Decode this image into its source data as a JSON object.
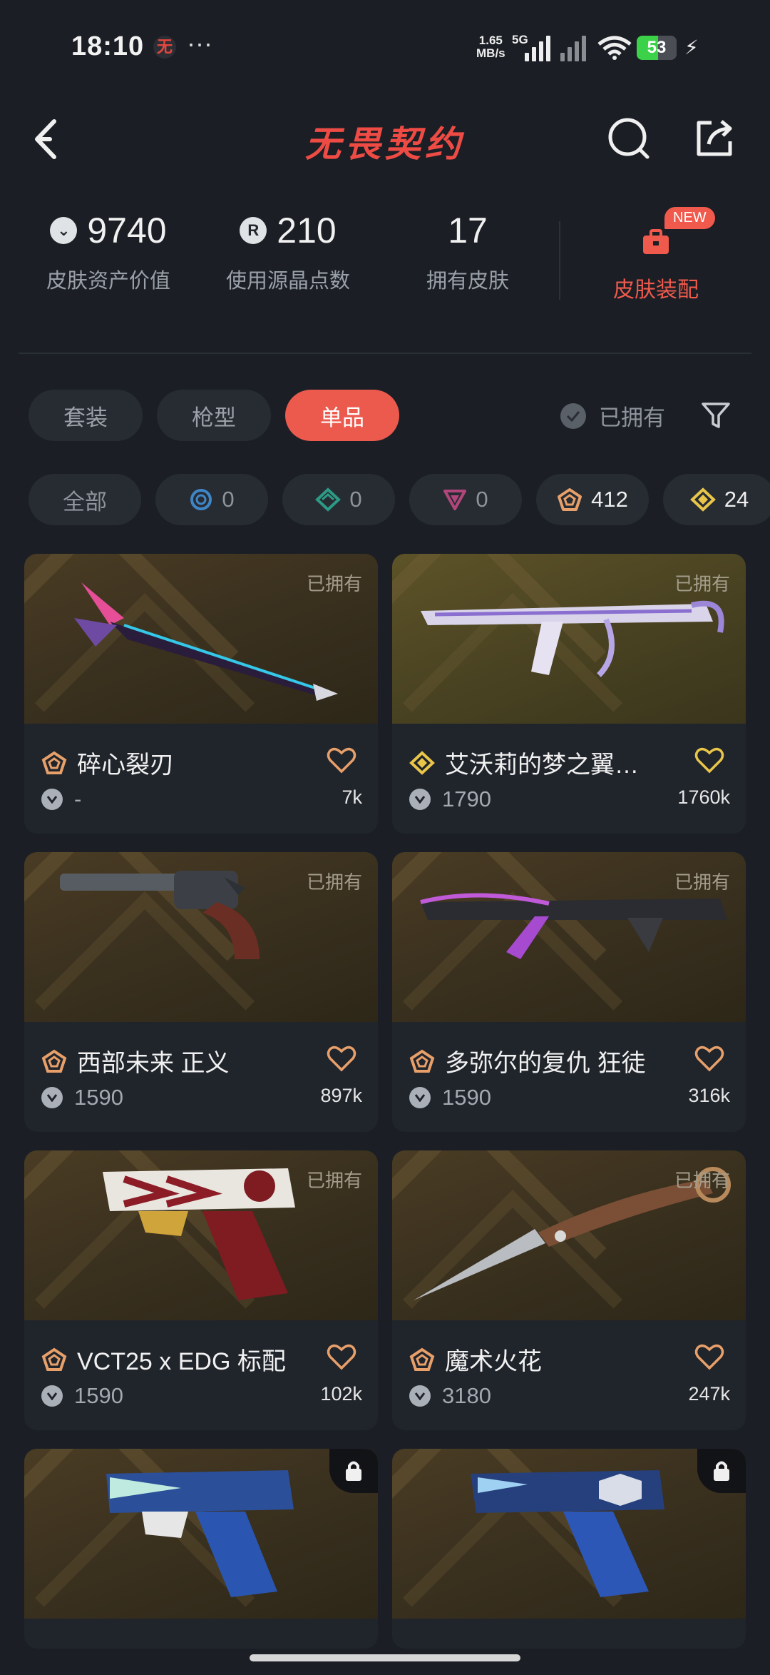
{
  "status_bar": {
    "time": "18:10",
    "app_badge": "无",
    "dots": "···",
    "speed_value": "1.65",
    "speed_unit": "MB/s",
    "network": "5G",
    "battery": "53",
    "battery_level": 0.53
  },
  "header": {
    "title": "无畏契约"
  },
  "stats": [
    {
      "value": "9740",
      "label": "皮肤资产价值",
      "icon": "vp-coin-icon"
    },
    {
      "value": "210",
      "label": "使用源晶点数",
      "icon": "radianite-icon"
    },
    {
      "value": "17",
      "label": "拥有皮肤"
    }
  ],
  "equip": {
    "badge": "NEW",
    "label": "皮肤装配"
  },
  "tabs": [
    "套装",
    "枪型",
    "单品"
  ],
  "active_tab": "单品",
  "owned_filter": "已拥有",
  "rarity_chips": [
    {
      "label": "全部"
    },
    {
      "label": "0",
      "icon": "select-tier-icon",
      "color": "#3f86c7"
    },
    {
      "label": "0",
      "icon": "deluxe-tier-icon",
      "color": "#2c9a84"
    },
    {
      "label": "0",
      "icon": "premium-tier-icon",
      "color": "#b2467c"
    },
    {
      "label": "412",
      "icon": "ultra-tier-icon",
      "color": "#e8a06a"
    },
    {
      "label": "24",
      "icon": "exclusive-tier-icon",
      "color": "#e9c649"
    }
  ],
  "cards": [
    {
      "name": "碎心裂刃",
      "price": "-",
      "likes": "7k",
      "status": "已拥有",
      "tier_color": "#e8a06a",
      "heart_color": "#e8a06a"
    },
    {
      "name": "艾沃莉的梦之翼…",
      "price": "1790",
      "likes": "1760k",
      "status": "已拥有",
      "tier_color": "#e9c649",
      "heart_color": "#e9c649"
    },
    {
      "name": "西部未来 正义",
      "price": "1590",
      "likes": "897k",
      "status": "已拥有",
      "tier_color": "#e8a06a",
      "heart_color": "#e8a06a"
    },
    {
      "name": "多弥尔的复仇 狂徒",
      "price": "1590",
      "likes": "316k",
      "status": "已拥有",
      "tier_color": "#e8a06a",
      "heart_color": "#e8a06a"
    },
    {
      "name": "VCT25 x EDG 标配",
      "price": "1590",
      "likes": "102k",
      "status": "已拥有",
      "tier_color": "#e8a06a",
      "heart_color": "#e8a06a"
    },
    {
      "name": "魔术火花",
      "price": "3180",
      "likes": "247k",
      "status": "已拥有",
      "tier_color": "#e8a06a",
      "heart_color": "#e8a06a"
    },
    {
      "name": "",
      "price": "",
      "likes": "",
      "status": "locked"
    },
    {
      "name": "",
      "price": "",
      "likes": "",
      "status": "locked"
    }
  ]
}
